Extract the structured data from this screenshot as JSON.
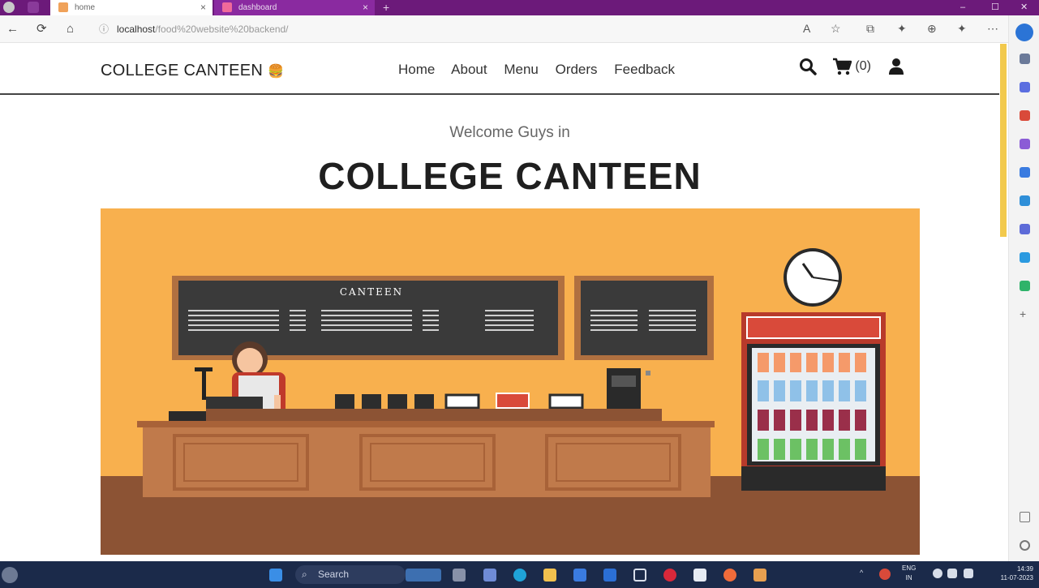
{
  "browser": {
    "tabs": [
      {
        "label": "home"
      },
      {
        "label": "dashboard"
      }
    ],
    "new_tab": "+",
    "close_glyph": "×",
    "url_host": "localhost",
    "url_path": "/food%20website%20backend/",
    "window_controls": {
      "minimize": "–",
      "maximize": "☐",
      "close": "✕"
    },
    "nav": {
      "back": "←",
      "refresh": "⟳",
      "home": "⌂",
      "info": "ⓘ"
    },
    "toolbar_glyphs": {
      "read_aloud": "A",
      "favorite": "☆",
      "split": "⧉",
      "extensions": "✦",
      "collections": "⊕",
      "more": "⋯"
    }
  },
  "site": {
    "logo": "COLLEGE CANTEEN",
    "logo_emoji": "🍔",
    "nav": [
      "Home",
      "About",
      "Menu",
      "Orders",
      "Feedback"
    ],
    "cart_count": "(0)"
  },
  "hero": {
    "welcome": "Welcome Guys in",
    "title": "COLLEGE CANTEEN",
    "sign": "CANTEEN"
  },
  "taskbar": {
    "search_placeholder": "Search",
    "lang_top": "ENG",
    "lang_bottom": "IN",
    "time": "14:39",
    "date": "11-07-2023"
  },
  "colors": {
    "tabbar": "#6c1a7a",
    "hero_bg": "#f8b04e",
    "floor": "#8c5334",
    "counter": "#c07a4b",
    "board": "#3a3a3a",
    "taskbar": "#1b2a4a"
  }
}
